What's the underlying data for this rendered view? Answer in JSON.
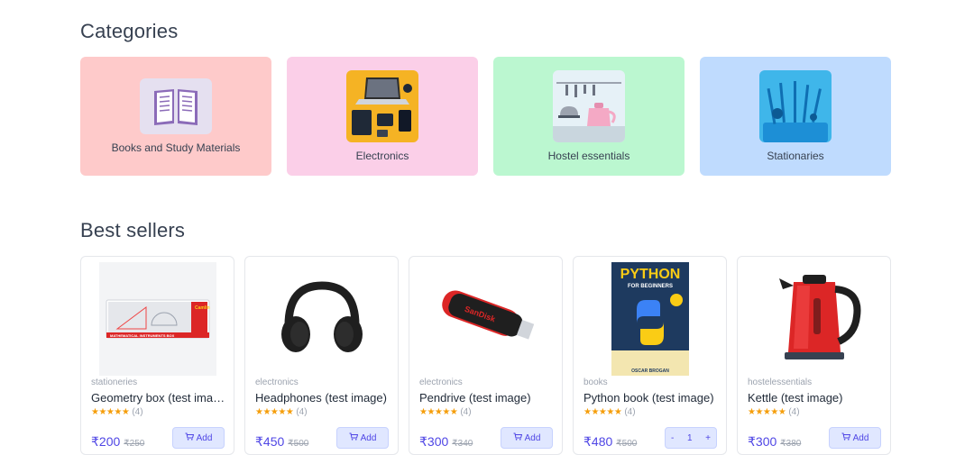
{
  "categories": {
    "title": "Categories",
    "items": [
      {
        "label": "Books and Study Materials",
        "color": "#fecaca"
      },
      {
        "label": "Electronics",
        "color": "#fbcfe8"
      },
      {
        "label": "Hostel essentials",
        "color": "#bbf7d0"
      },
      {
        "label": "Stationaries",
        "color": "#bfdbfe"
      }
    ]
  },
  "best_sellers": {
    "title": "Best sellers",
    "products": [
      {
        "category": "stationeries",
        "name": "Geometry box (test image)",
        "stars": "★★★★★",
        "reviews": "(4)",
        "price": "₹200",
        "mrp": "₹250",
        "action": "Add"
      },
      {
        "category": "electronics",
        "name": "Headphones (test image)",
        "stars": "★★★★★",
        "reviews": "(4)",
        "price": "₹450",
        "mrp": "₹500",
        "action": "Add"
      },
      {
        "category": "electronics",
        "name": "Pendrive (test image)",
        "stars": "★★★★★",
        "reviews": "(4)",
        "price": "₹300",
        "mrp": "₹340",
        "action": "Add"
      },
      {
        "category": "books",
        "name": "Python book (test image)",
        "stars": "★★★★★",
        "reviews": "(4)",
        "price": "₹480",
        "mrp": "₹500",
        "qty": "1",
        "minus": "-",
        "plus": "+"
      },
      {
        "category": "hostelessentials",
        "name": "Kettle (test image)",
        "stars": "★★★★★",
        "reviews": "(4)",
        "price": "₹300",
        "mrp": "₹380",
        "action": "Add"
      }
    ]
  },
  "product_images": {
    "geometry_box_brand": "Camlin",
    "geometry_box_caption": "MATHEMATICAL INSTRUMENTS BOX",
    "pendrive_brand": "SanDisk",
    "python_book_title": "PYTHON",
    "python_book_subtitle": "FOR BEGINNERS",
    "python_book_author": "OSCAR BROGAN"
  },
  "icons": {
    "cart": "cart-icon",
    "stars": "star-icon"
  }
}
